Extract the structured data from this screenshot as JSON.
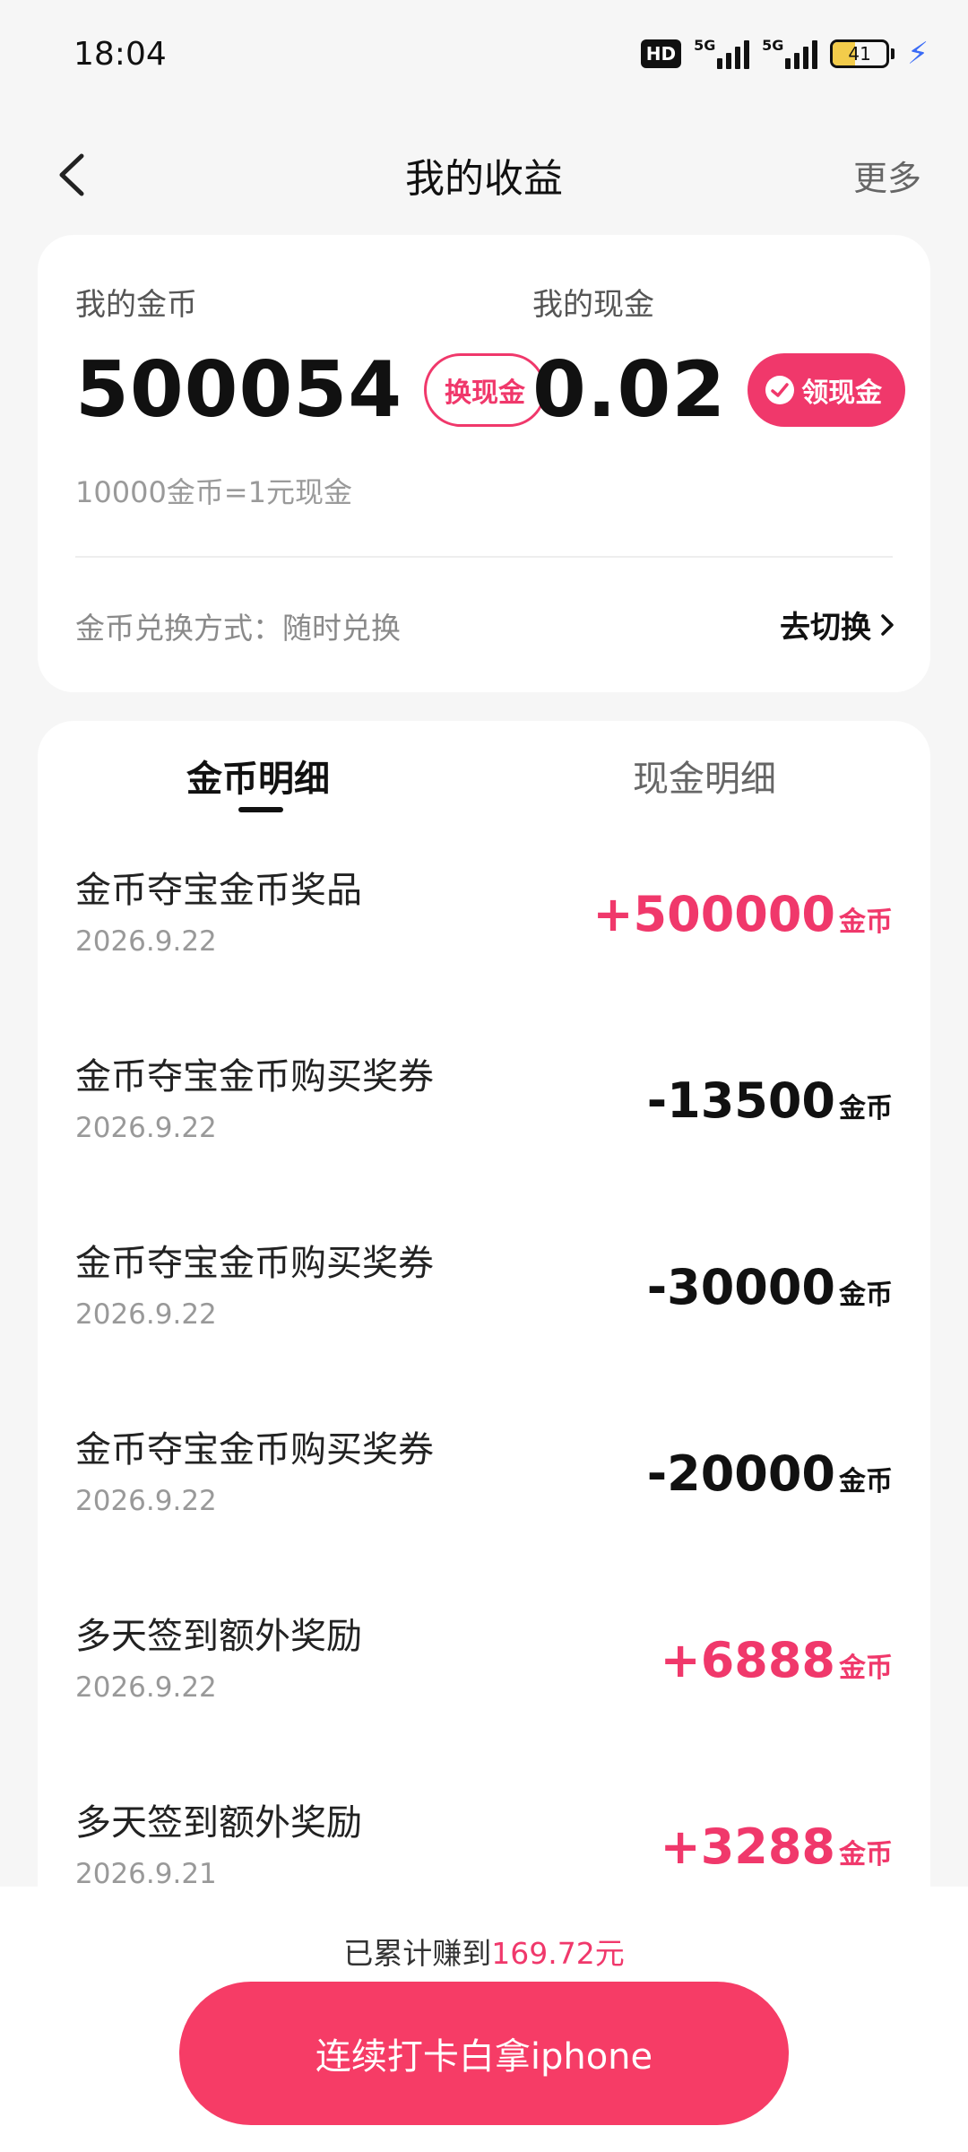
{
  "status_bar": {
    "time": "18:04",
    "hd_label": "HD",
    "network_1": "5G",
    "network_2": "5G",
    "battery_level": "41"
  },
  "header": {
    "title": "我的收益",
    "more_label": "更多"
  },
  "balance": {
    "coin_label": "我的金币",
    "coin_value": "500054",
    "exchange_button": "换现金",
    "cash_label": "我的现金",
    "cash_value": "0.02",
    "withdraw_button": "领现金",
    "rate_text": "10000金币=1元现金",
    "method_text": "金币兑换方式：随时兑换",
    "switch_label": "去切换"
  },
  "tabs": {
    "coin_detail": "金币明细",
    "cash_detail": "现金明细"
  },
  "records": [
    {
      "title": "金币夺宝金币奖品",
      "date": "2026.9.22",
      "amount": "+500000",
      "unit": "金币",
      "type": "pos"
    },
    {
      "title": "金币夺宝金币购买奖券",
      "date": "2026.9.22",
      "amount": "-13500",
      "unit": "金币",
      "type": "neg"
    },
    {
      "title": "金币夺宝金币购买奖券",
      "date": "2026.9.22",
      "amount": "-30000",
      "unit": "金币",
      "type": "neg"
    },
    {
      "title": "金币夺宝金币购买奖券",
      "date": "2026.9.22",
      "amount": "-20000",
      "unit": "金币",
      "type": "neg"
    },
    {
      "title": "多天签到额外奖励",
      "date": "2026.9.22",
      "amount": "+6888",
      "unit": "金币",
      "type": "pos"
    },
    {
      "title": "多天签到额外奖励",
      "date": "2026.9.21",
      "amount": "+3288",
      "unit": "金币",
      "type": "pos"
    }
  ],
  "footer": {
    "total_prefix": "已累计赚到",
    "total_amount": "169.72元",
    "cta_label": "连续打卡白拿iphone"
  },
  "colors": {
    "accent": "#f0386b",
    "cta": "#f63c66",
    "background": "#f6f6f6"
  }
}
